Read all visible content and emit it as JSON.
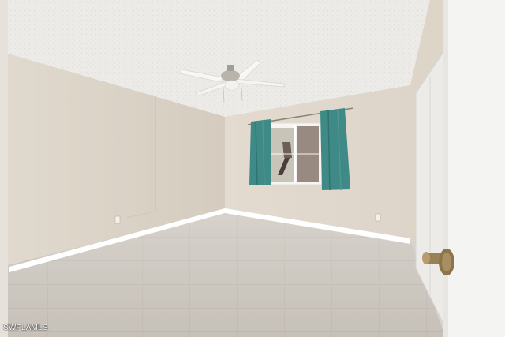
{
  "photo": {
    "watermark_text": "SWFLAMLS"
  },
  "palette": {
    "wall": "#e2dbd0",
    "wall_shadow": "#d6cfc4",
    "ceiling": "#ededeb",
    "floor": "#d0cbc4",
    "curtain": "#3f8a86",
    "door": "#f4f4f3",
    "baseboard": "#ffffff",
    "door_knob": "#9a8056"
  }
}
